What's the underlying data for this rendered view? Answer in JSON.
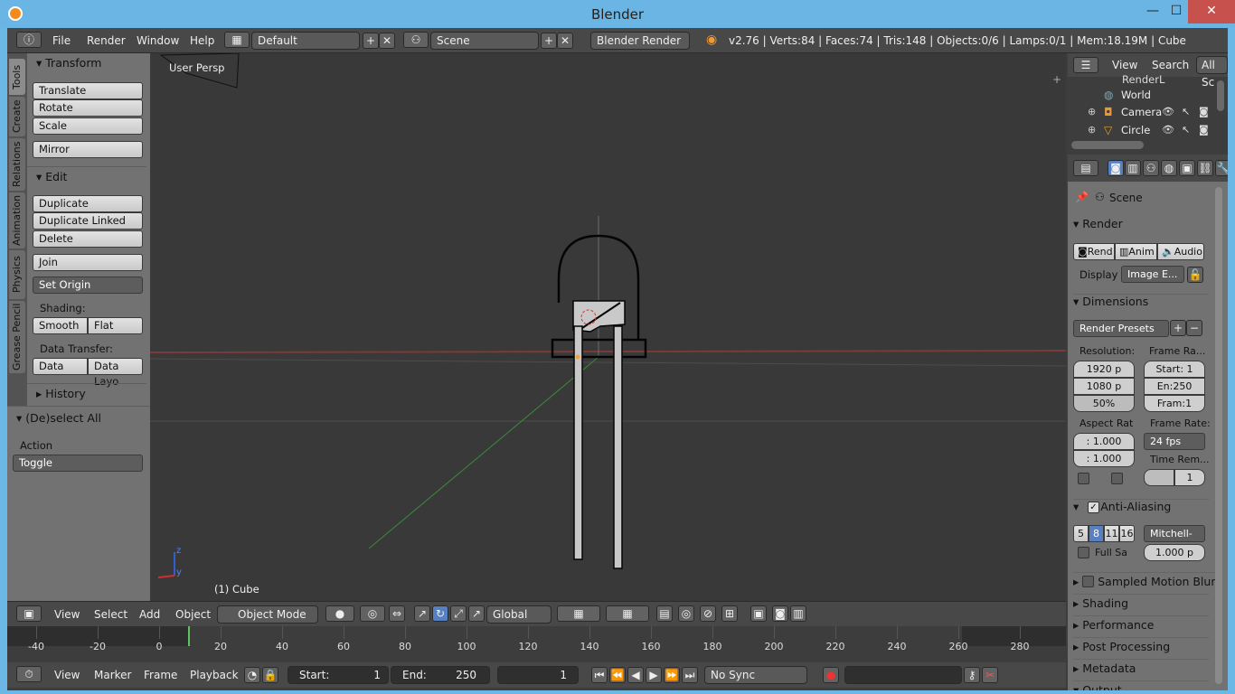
{
  "window": {
    "title": "Blender",
    "minimize": "—",
    "maximize": "☐",
    "close": "✕"
  },
  "topbar": {
    "menus": [
      "File",
      "Render",
      "Window",
      "Help"
    ],
    "layout": "Default",
    "scene": "Scene",
    "engine": "Blender Render",
    "stats": "v2.76 | Verts:84 | Faces:74 | Tris:148 | Objects:0/6 | Lamps:0/1 | Mem:18.19M | Cube"
  },
  "tabs": [
    "Tools",
    "Create",
    "Relations",
    "Animation",
    "Physics",
    "Grease Pencil"
  ],
  "transform": {
    "title": "Transform",
    "translate": "Translate",
    "rotate": "Rotate",
    "scale": "Scale",
    "mirror": "Mirror"
  },
  "edit": {
    "title": "Edit",
    "duplicate": "Duplicate",
    "duplicate_linked": "Duplicate Linked",
    "delete": "Delete",
    "join": "Join",
    "set_origin": "Set Origin",
    "shading_label": "Shading:",
    "smooth": "Smooth",
    "flat": "Flat",
    "data_transfer_label": "Data Transfer:",
    "data": "Data",
    "data_layo": "Data Layo"
  },
  "history": {
    "title": "History"
  },
  "deselect": {
    "title": "(De)select All",
    "action_label": "Action",
    "action_value": "Toggle"
  },
  "viewport": {
    "persp_label": "User Persp",
    "object_label": "(1) Cube"
  },
  "vp_header": {
    "menus": [
      "View",
      "Select",
      "Add",
      "Object"
    ],
    "mode": "Object Mode",
    "orientation": "Global"
  },
  "timeline": {
    "ticks": [
      "-40",
      "-20",
      "0",
      "20",
      "40",
      "60",
      "80",
      "100",
      "120",
      "140",
      "160",
      "180",
      "200",
      "220",
      "240",
      "260",
      "280"
    ]
  },
  "tl_bar": {
    "menus": [
      "View",
      "Marker",
      "Frame",
      "Playback"
    ],
    "start_label": "Start:",
    "start_value": "1",
    "end_label": "End:",
    "end_value": "250",
    "current": "1",
    "sync": "No Sync"
  },
  "outliner": {
    "menus": [
      "View",
      "Search"
    ],
    "filter": "All Sc",
    "items": [
      "RenderL",
      "World",
      "Camera",
      "Circle"
    ]
  },
  "properties": {
    "scene": "Scene",
    "render_title": "Render",
    "rend": "Rend",
    "anim": "Anim",
    "audio": "Audio",
    "display_label": "Display",
    "display_value": "Image E...",
    "dimensions_title": "Dimensions",
    "presets": "Render Presets",
    "resolution_label": "Resolution:",
    "res_x": "1920 p",
    "res_y": "1080 p",
    "res_pct": "50%",
    "framerange_label": "Frame Ra...",
    "start": "Start: 1",
    "end": "En:250",
    "frame": "Fram:1",
    "aspect_label": "Aspect Rat",
    "aspect_x": ": 1.000",
    "aspect_y": ": 1.000",
    "framerate_label": "Frame Rate:",
    "framerate": "24 fps",
    "timerem_label": "Time Rem...",
    "timerem": "1",
    "aa_title": "Anti-Aliasing",
    "aa_5": "5",
    "aa_8": "8",
    "aa_11": "11",
    "aa_16": "16",
    "aa_filter": "Mitchell-",
    "fullsa": "Full Sa",
    "fullsa_val": "1.000 p",
    "motion_blur": "Sampled Motion Blur",
    "shading": "Shading",
    "performance": "Performance",
    "post": "Post Processing",
    "metadata": "Metadata",
    "output": "Output"
  },
  "colors": {
    "accent_blue": "#5680c2",
    "header": "#484848",
    "panel": "#727272",
    "viewport": "#393939"
  }
}
